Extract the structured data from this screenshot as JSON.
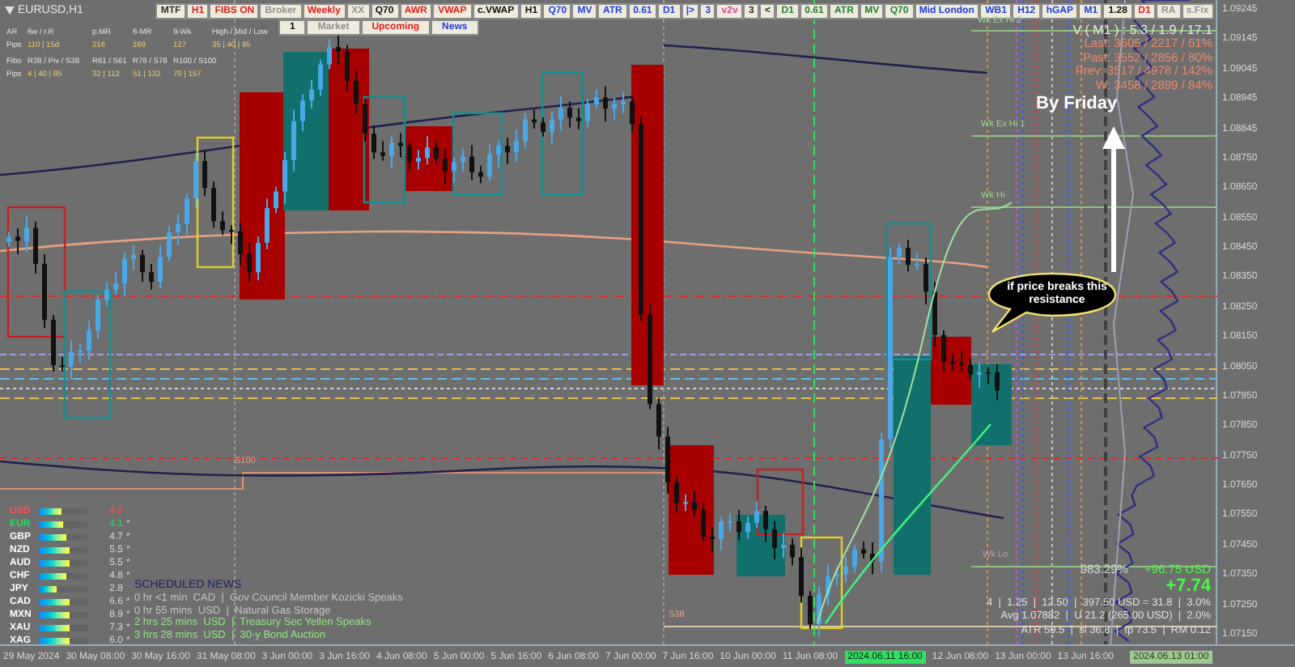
{
  "window": {
    "title": "EURUSD,H1"
  },
  "toolbar": {
    "row_1": [
      {
        "label": "MTF",
        "color": "#303030"
      },
      {
        "label": "H1",
        "color": "#e02020"
      },
      {
        "label": "FIBS ON",
        "color": "#e02020"
      },
      {
        "label": "Broker",
        "color": "#909090"
      },
      {
        "label": "Weekly",
        "color": "#e02020"
      },
      {
        "label": "XX",
        "color": "#909090"
      },
      {
        "label": "Q70",
        "color": "#101010"
      },
      {
        "label": "AWR",
        "color": "#e02020"
      },
      {
        "label": "VWAP",
        "color": "#e02020"
      },
      {
        "label": "c.VWAP",
        "color": "#101010"
      },
      {
        "label": "H1",
        "color": "#101010"
      },
      {
        "label": "Q70",
        "color": "#2040e0"
      },
      {
        "label": "MV",
        "color": "#2040e0"
      },
      {
        "label": "ATR",
        "color": "#2040e0"
      },
      {
        "label": "0.61",
        "color": "#2040e0"
      },
      {
        "label": "D1",
        "color": "#2040e0"
      },
      {
        "label": "|>",
        "color": "#2040e0"
      },
      {
        "label": "3",
        "color": "#2040e0"
      },
      {
        "label": "v2v",
        "color": "#e040a0"
      },
      {
        "label": "3",
        "color": "#303030"
      },
      {
        "label": "<",
        "color": "#303030"
      },
      {
        "label": "D1",
        "color": "#208030"
      },
      {
        "label": "0.61",
        "color": "#208030"
      },
      {
        "label": "ATR",
        "color": "#208030"
      },
      {
        "label": "MV",
        "color": "#208030"
      },
      {
        "label": "Q70",
        "color": "#208030"
      },
      {
        "label": "Mid London",
        "color": "#2040e0"
      },
      {
        "label": "WB1",
        "color": "#2040e0"
      },
      {
        "label": "H12",
        "color": "#2040e0"
      },
      {
        "label": "hGAP",
        "color": "#2040e0"
      },
      {
        "label": "M1",
        "color": "#2040e0"
      },
      {
        "label": "1.28",
        "color": "#101010"
      },
      {
        "label": "D1",
        "color": "#e02020"
      },
      {
        "label": "RA",
        "color": "#909090"
      },
      {
        "label": "s.Fix",
        "color": "#909090"
      }
    ],
    "row_2": [
      {
        "label": "1",
        "color": "#101010"
      },
      {
        "label": "Market",
        "color": "#909090"
      },
      {
        "label": "Upcoming",
        "color": "#e02020"
      },
      {
        "label": "News",
        "color": "#2040e0"
      }
    ]
  },
  "stats_panel": {
    "rows": [
      [
        "AR",
        "6w / r.R",
        "p.MR",
        "6-MR",
        "9-Wk",
        "High / Mid / Low"
      ],
      [
        "Pips",
        "110 | 15d",
        "216",
        "169",
        "127",
        "35 | 40 | 95"
      ],
      [
        "Fibo",
        "R38 / Piv / S38",
        "R61 / S61",
        "R78 / S78",
        "R100 / S100"
      ],
      [
        "Pips",
        "4 | 40 | 85",
        "32 | 112",
        "51 | 132",
        "70 | 157"
      ]
    ]
  },
  "volume_stats": {
    "header": "V ( M1 ) : 5.3 / 1.9 / 17.1",
    "lines": [
      "Last: 3605 / 2217 / 61%",
      "Past: 3552 / 2856 / 80%",
      "Prev: 3517 / 4978 / 142%",
      "W: 3458 / 2899 / 84%"
    ]
  },
  "level_labels": [
    {
      "text": "Wk Ex Hi 2",
      "kind": "high"
    },
    {
      "text": "Wk Ex Hi 1",
      "kind": "high"
    },
    {
      "text": "Wk Hi",
      "kind": "high"
    },
    {
      "text": "Wk Lo",
      "kind": "low"
    },
    {
      "text": "S100",
      "kind": "pivot"
    },
    {
      "text": "S38",
      "kind": "pivot"
    }
  ],
  "annotations": {
    "arrow_label": "By Friday",
    "bubble": "if price breaks this resistance"
  },
  "currency_strength": [
    {
      "currency": "USD",
      "color": "#ff5050",
      "level": 0.45,
      "value": "4.0"
    },
    {
      "currency": "EUR",
      "color": "#20e060",
      "level": 0.5,
      "value": "4.1",
      "marker": "*"
    },
    {
      "currency": "GBP",
      "color": "#ffffff",
      "level": 0.55,
      "value": "4.7",
      "marker": "*"
    },
    {
      "currency": "NZD",
      "color": "#ffffff",
      "level": 0.62,
      "value": "5.5",
      "marker": "*"
    },
    {
      "currency": "AUD",
      "color": "#ffffff",
      "level": 0.62,
      "value": "5.5",
      "marker": "*"
    },
    {
      "currency": "CHF",
      "color": "#ffffff",
      "level": 0.55,
      "value": "4.8",
      "marker": "*"
    },
    {
      "currency": "JPY",
      "color": "#ffffff",
      "level": 0.37,
      "value": "2.8"
    },
    {
      "currency": "CAD",
      "color": "#ffffff",
      "level": 0.62,
      "value": "6.6",
      "marker": "*"
    },
    {
      "currency": "MXN",
      "color": "#ffffff",
      "level": 0.62,
      "value": "8.9",
      "marker": "*"
    },
    {
      "currency": "XAU",
      "color": "#ffffff",
      "level": 0.62,
      "value": "7.3",
      "marker": "*"
    },
    {
      "currency": "XAG",
      "color": "#ffffff",
      "level": 0.62,
      "value": "6.0",
      "marker": "*"
    }
  ],
  "scheduled_news": {
    "title": "SCHEDULED NEWS",
    "items": [
      {
        "text": "0 hr <1 min  CAD  |  Gov Council Member Kozicki Speaks",
        "highlighted": false
      },
      {
        "text": "0 hr 55 mins  USD  |  Natural Gas Storage",
        "highlighted": false
      },
      {
        "text": "2 hrs 25 mins  USD  |  Treasury Sec Yellen Speaks",
        "highlighted": true
      },
      {
        "text": "3 hrs 28 mins  USD  |  30-y Bond Auction",
        "highlighted": true
      }
    ]
  },
  "trade_info": {
    "percent": "983.29%",
    "profit": "+96.75 USD",
    "value": "+7.74",
    "lines": [
      "4  |  1.25  |  12.50  |  397.50 USD = 31.8  |  3.0%",
      "Avg 1.07882  |  U 21.2 (265.00 USD)  |  2.0%",
      "ATR 59.5  |  sl 36.8  |  tp 73.5  |  RM 0.12"
    ]
  },
  "price_axis": [
    "1.09245",
    "1.09145",
    "1.09045",
    "1.08945",
    "1.08845",
    "1.08750",
    "1.08650",
    "1.08550",
    "1.08450",
    "1.08350",
    "1.08250",
    "1.08150",
    "1.08050",
    "1.07950",
    "1.07850",
    "1.07750",
    "1.07650",
    "1.07550",
    "1.07450",
    "1.07350",
    "1.07250",
    "1.07150"
  ],
  "time_axis": [
    {
      "text": "29 May 2024",
      "kind": "tick"
    },
    {
      "text": "30 May 08:00",
      "kind": "tick"
    },
    {
      "text": "30 May 16:00",
      "kind": "tick"
    },
    {
      "text": "31 May 08:00",
      "kind": "tick"
    },
    {
      "text": "3 Jun 00:00",
      "kind": "tick"
    },
    {
      "text": "3 Jun 16:00",
      "kind": "tick"
    },
    {
      "text": "4 Jun 08:00",
      "kind": "tick"
    },
    {
      "text": "5 Jun 00:00",
      "kind": "tick"
    },
    {
      "text": "5 Jun 16:00",
      "kind": "tick"
    },
    {
      "text": "6 Jun 08:00",
      "kind": "tick"
    },
    {
      "text": "7 Jun 00:00",
      "kind": "tick"
    },
    {
      "text": "7 Jun 16:00",
      "kind": "tick"
    },
    {
      "text": "10 Jun 00:00",
      "kind": "tick"
    },
    {
      "text": "11 Jun 08:00",
      "kind": "tick"
    },
    {
      "text": "2024.06.11 16:00",
      "kind": "crosshair"
    },
    {
      "text": "12 Jun 08:00",
      "kind": "tick"
    },
    {
      "text": "13 Jun 00:00",
      "kind": "tick"
    },
    {
      "text": "13 Jun 16:00",
      "kind": "tick"
    },
    {
      "text": "2024.06.13 01:00",
      "kind": "cursor"
    }
  ]
}
